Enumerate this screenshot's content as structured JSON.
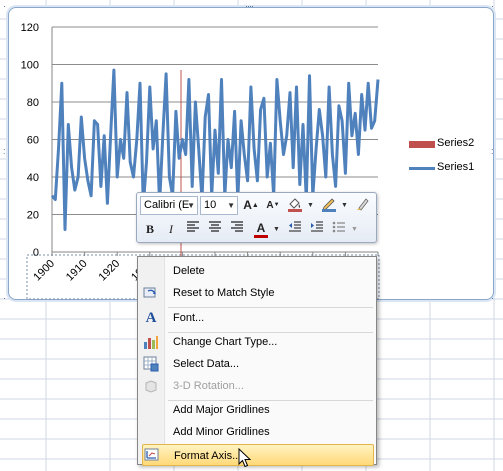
{
  "chart_data": {
    "type": "line",
    "y_ticks": [
      "0",
      "20",
      "40",
      "60",
      "80",
      "100",
      "120"
    ],
    "ylim": [
      0,
      120
    ],
    "x_tick_labels": [
      "1900",
      "1910",
      "1920",
      "1930"
    ],
    "series": [
      {
        "name": "Series1",
        "color": "#4f81bd",
        "x": [
          1900,
          1901,
          1902,
          1903,
          1904,
          1905,
          1906,
          1907,
          1908,
          1909,
          1910,
          1911,
          1912,
          1913,
          1914,
          1915,
          1916,
          1917,
          1918,
          1919,
          1920,
          1921,
          1922,
          1923,
          1924,
          1925,
          1926,
          1927,
          1928,
          1929,
          1930,
          1931,
          1932,
          1933,
          1934,
          1935,
          1936,
          1937,
          1938,
          1939,
          1940,
          1941,
          1942,
          1943,
          1944,
          1945,
          1946,
          1947,
          1948,
          1949,
          1950,
          1951,
          1952,
          1953,
          1954,
          1955,
          1956,
          1957,
          1958,
          1959,
          1960,
          1961,
          1962,
          1963,
          1964,
          1965,
          1966,
          1967,
          1968,
          1969,
          1970,
          1971,
          1972,
          1973,
          1974,
          1975,
          1976,
          1977,
          1978,
          1979,
          1980,
          1981,
          1982,
          1983,
          1984,
          1985,
          1986,
          1987,
          1988,
          1989,
          1990,
          1991,
          1992,
          1993,
          1994,
          1995,
          1996,
          1997,
          1998,
          1999,
          2000
        ],
        "values": [
          30,
          28,
          55,
          90,
          12,
          68,
          45,
          33,
          40,
          72,
          50,
          38,
          30,
          70,
          68,
          35,
          62,
          26,
          63,
          97,
          40,
          60,
          50,
          85,
          48,
          40,
          60,
          90,
          25,
          48,
          88,
          55,
          70,
          26,
          62,
          95,
          40,
          30,
          75,
          50,
          60,
          52,
          92,
          35,
          80,
          55,
          28,
          72,
          84,
          30,
          65,
          42,
          92,
          30,
          60,
          45,
          75,
          28,
          70,
          52,
          38,
          88,
          55,
          38,
          76,
          82,
          40,
          58,
          30,
          92,
          70,
          52,
          62,
          85,
          45,
          88,
          36,
          68,
          28,
          94,
          30,
          55,
          76,
          62,
          40,
          88,
          52,
          35,
          78,
          70,
          42,
          90,
          62,
          74,
          52,
          84,
          65,
          90,
          66,
          70,
          92
        ]
      },
      {
        "name": "Series2",
        "color": "#c0504d",
        "values": []
      }
    ],
    "grid": true,
    "legend": "right"
  },
  "legend": [
    {
      "name": "Series2",
      "color": "#c0504d",
      "kind": "bar"
    },
    {
      "name": "Series1",
      "color": "#4f81bd",
      "kind": "line"
    }
  ],
  "mini_toolbar": {
    "font_name": "Calibri (E",
    "font_size": "10",
    "grow_font": "A",
    "shrink_font": "A",
    "bold": "B",
    "italic": "I",
    "font_color_glyph": "A",
    "font_color": "#c00000",
    "fill_color": "#c0504d",
    "line_color": "#4f81bd"
  },
  "context_menu": {
    "items": [
      {
        "label": "Delete",
        "icon": "",
        "disabled": false
      },
      {
        "label": "Reset to Match Style",
        "icon": "reset-style-icon",
        "disabled": false
      },
      {
        "label": "Font...",
        "icon": "font-icon",
        "disabled": false
      },
      {
        "label": "Change Chart Type...",
        "icon": "chart-type-icon",
        "disabled": false
      },
      {
        "label": "Select Data...",
        "icon": "select-data-icon",
        "disabled": false
      },
      {
        "label": "3-D Rotation...",
        "icon": "3d-rotation-icon",
        "disabled": true
      },
      {
        "label": "Add Major Gridlines",
        "icon": "",
        "disabled": false
      },
      {
        "label": "Add Minor Gridlines",
        "icon": "",
        "disabled": false
      },
      {
        "label": "Format Axis...",
        "icon": "format-axis-icon",
        "disabled": false,
        "highlighted": true
      }
    ]
  }
}
